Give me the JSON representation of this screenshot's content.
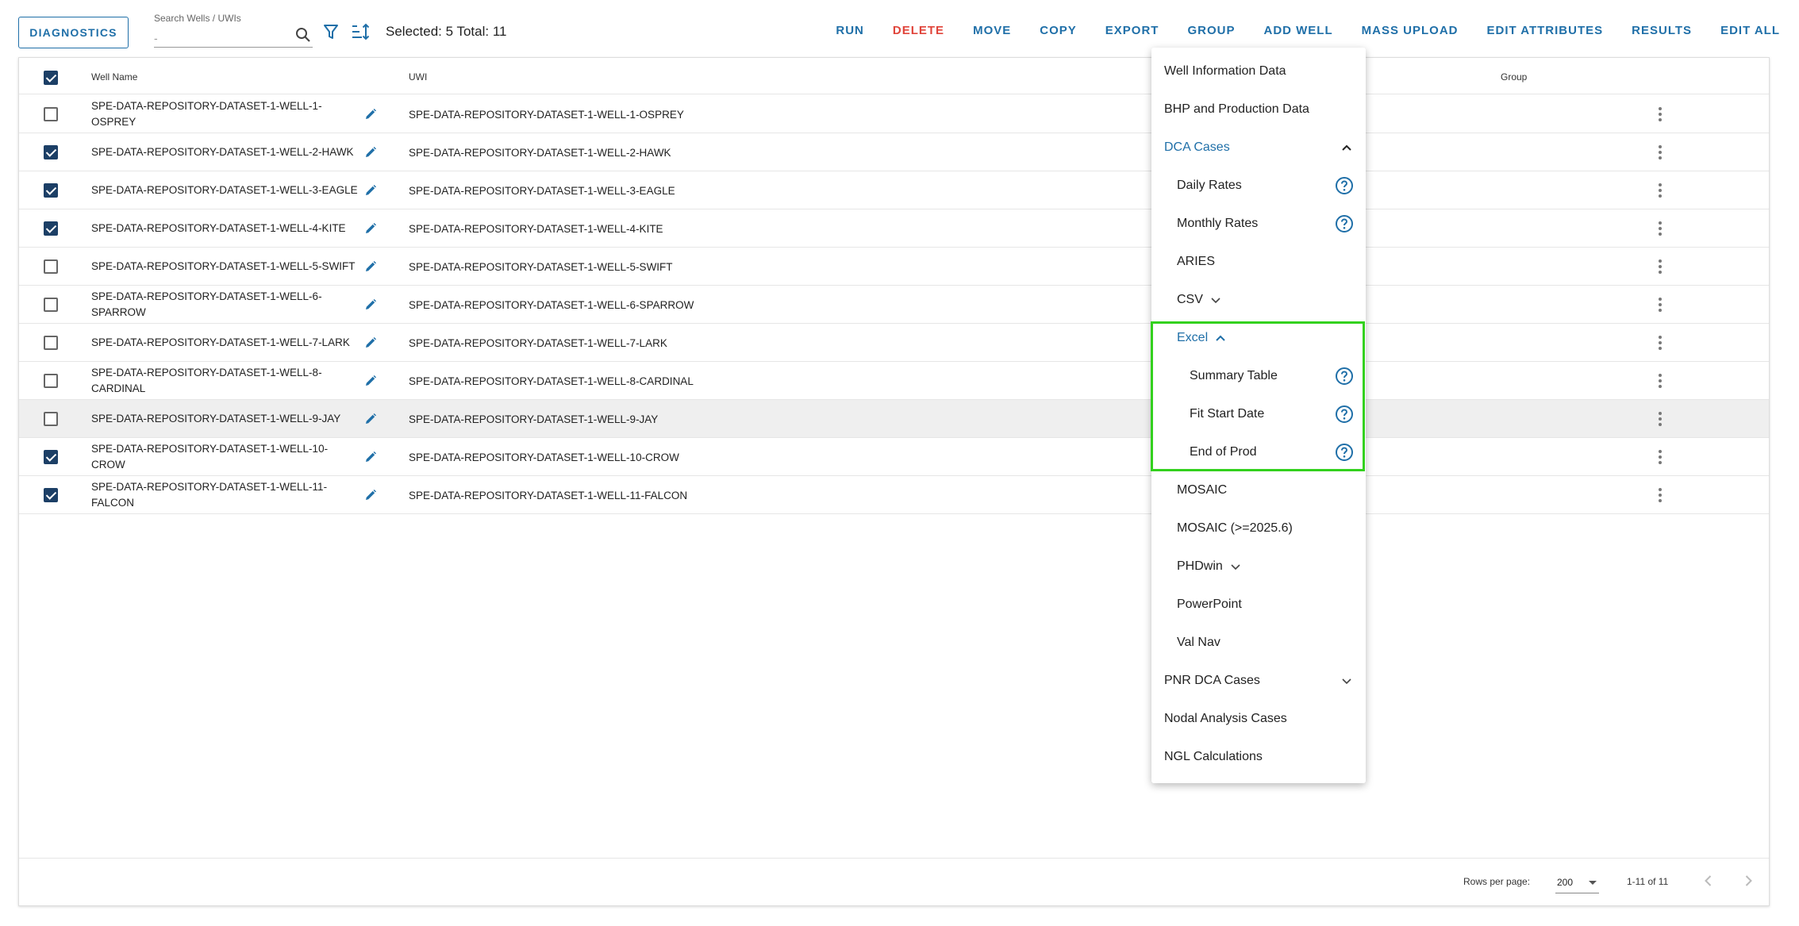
{
  "toolbar": {
    "diagnostics_label": "DIAGNOSTICS",
    "search_label": "Search Wells / UWIs",
    "search_value": "-",
    "selected_info": "Selected: 5 Total: 11",
    "actions": [
      {
        "label": "RUN",
        "danger": false
      },
      {
        "label": "DELETE",
        "danger": true
      },
      {
        "label": "MOVE",
        "danger": false
      },
      {
        "label": "COPY",
        "danger": false
      },
      {
        "label": "EXPORT",
        "danger": false
      },
      {
        "label": "GROUP",
        "danger": false
      },
      {
        "label": "ADD WELL",
        "danger": false
      },
      {
        "label": "MASS UPLOAD",
        "danger": false
      },
      {
        "label": "EDIT ATTRIBUTES",
        "danger": false
      },
      {
        "label": "RESULTS",
        "danger": false
      },
      {
        "label": "EDIT ALL",
        "danger": false
      }
    ]
  },
  "table": {
    "columns": {
      "name": "Well Name",
      "uwi": "UWI",
      "group": "Group"
    },
    "header_checked": true,
    "rows": [
      {
        "name": "SPE-DATA-REPOSITORY-DATASET-1-WELL-1-OSPREY",
        "uwi": "SPE-DATA-REPOSITORY-DATASET-1-WELL-1-OSPREY",
        "checked": false
      },
      {
        "name": "SPE-DATA-REPOSITORY-DATASET-1-WELL-2-HAWK",
        "uwi": "SPE-DATA-REPOSITORY-DATASET-1-WELL-2-HAWK",
        "checked": true
      },
      {
        "name": "SPE-DATA-REPOSITORY-DATASET-1-WELL-3-EAGLE",
        "uwi": "SPE-DATA-REPOSITORY-DATASET-1-WELL-3-EAGLE",
        "checked": true
      },
      {
        "name": "SPE-DATA-REPOSITORY-DATASET-1-WELL-4-KITE",
        "uwi": "SPE-DATA-REPOSITORY-DATASET-1-WELL-4-KITE",
        "checked": true
      },
      {
        "name": "SPE-DATA-REPOSITORY-DATASET-1-WELL-5-SWIFT",
        "uwi": "SPE-DATA-REPOSITORY-DATASET-1-WELL-5-SWIFT",
        "checked": false
      },
      {
        "name": "SPE-DATA-REPOSITORY-DATASET-1-WELL-6-SPARROW",
        "uwi": "SPE-DATA-REPOSITORY-DATASET-1-WELL-6-SPARROW",
        "checked": false
      },
      {
        "name": "SPE-DATA-REPOSITORY-DATASET-1-WELL-7-LARK",
        "uwi": "SPE-DATA-REPOSITORY-DATASET-1-WELL-7-LARK",
        "checked": false
      },
      {
        "name": "SPE-DATA-REPOSITORY-DATASET-1-WELL-8-CARDINAL",
        "uwi": "SPE-DATA-REPOSITORY-DATASET-1-WELL-8-CARDINAL",
        "checked": false
      },
      {
        "name": "SPE-DATA-REPOSITORY-DATASET-1-WELL-9-JAY",
        "uwi": "SPE-DATA-REPOSITORY-DATASET-1-WELL-9-JAY",
        "checked": false,
        "hover": true
      },
      {
        "name": "SPE-DATA-REPOSITORY-DATASET-1-WELL-10-CROW",
        "uwi": "SPE-DATA-REPOSITORY-DATASET-1-WELL-10-CROW",
        "checked": true
      },
      {
        "name": "SPE-DATA-REPOSITORY-DATASET-1-WELL-11-FALCON",
        "uwi": "SPE-DATA-REPOSITORY-DATASET-1-WELL-11-FALCON",
        "checked": true
      }
    ]
  },
  "footer": {
    "rows_per_page_label": "Rows per page:",
    "rows_per_page_value": "200",
    "range": "1-11 of 11"
  },
  "export_menu": {
    "items": [
      {
        "label": "Well Information Data",
        "level": 0
      },
      {
        "label": "BHP and Production Data",
        "level": 0
      },
      {
        "label": "DCA Cases",
        "level": 0,
        "expanded": true,
        "chevron": "up-right"
      },
      {
        "label": "Daily Rates",
        "level": 1,
        "help": true
      },
      {
        "label": "Monthly Rates",
        "level": 1,
        "help": true
      },
      {
        "label": "ARIES",
        "level": 1
      },
      {
        "label": "CSV",
        "level": 1,
        "chevron": "down"
      },
      {
        "label": "Excel",
        "level": 1,
        "chevron": "up"
      },
      {
        "label": "Summary Table",
        "level": 2,
        "help": true
      },
      {
        "label": "Fit Start Date",
        "level": 2,
        "help": true
      },
      {
        "label": "End of Prod",
        "level": 2,
        "help": true
      },
      {
        "label": "MOSAIC",
        "level": 1
      },
      {
        "label": "MOSAIC (>=2025.6)",
        "level": 1
      },
      {
        "label": "PHDwin",
        "level": 1,
        "chevron": "down"
      },
      {
        "label": "PowerPoint",
        "level": 1
      },
      {
        "label": "Val Nav",
        "level": 1
      },
      {
        "label": "PNR DCA Cases",
        "level": 0,
        "chevron": "down-right"
      },
      {
        "label": "Nodal Analysis Cases",
        "level": 0
      },
      {
        "label": "NGL Calculations",
        "level": 0
      }
    ]
  },
  "colors": {
    "accent": "#1f6fa8",
    "danger": "#e0443a",
    "checkbox": "#1c3f66",
    "highlight": "#33d11e"
  }
}
